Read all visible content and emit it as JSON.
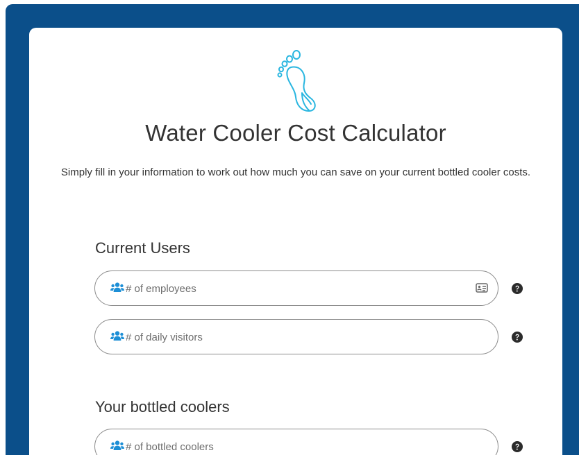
{
  "page": {
    "title": "Water Cooler Cost Calculator",
    "subtitle": "Simply fill in your information to work out how much you can save on your current bottled cooler costs.",
    "logo_icon": "footprint-leaf-icon"
  },
  "colors": {
    "frame_background": "#0b4f8a",
    "logo_stroke": "#29b6e0",
    "field_icon": "#1d8fd6",
    "help_icon": "#2b2b2b"
  },
  "sections": {
    "current_users": {
      "heading": "Current Users",
      "fields": {
        "employees": {
          "placeholder": "# of employees",
          "value": "",
          "icon": "users-icon",
          "trailing_icon": "contact-card-icon"
        },
        "visitors": {
          "placeholder": "# of daily visitors",
          "value": "",
          "icon": "users-icon"
        }
      }
    },
    "bottled_coolers": {
      "heading": "Your bottled coolers",
      "fields": {
        "coolers": {
          "placeholder": "# of bottled coolers",
          "value": "",
          "icon": "users-icon"
        }
      }
    }
  }
}
